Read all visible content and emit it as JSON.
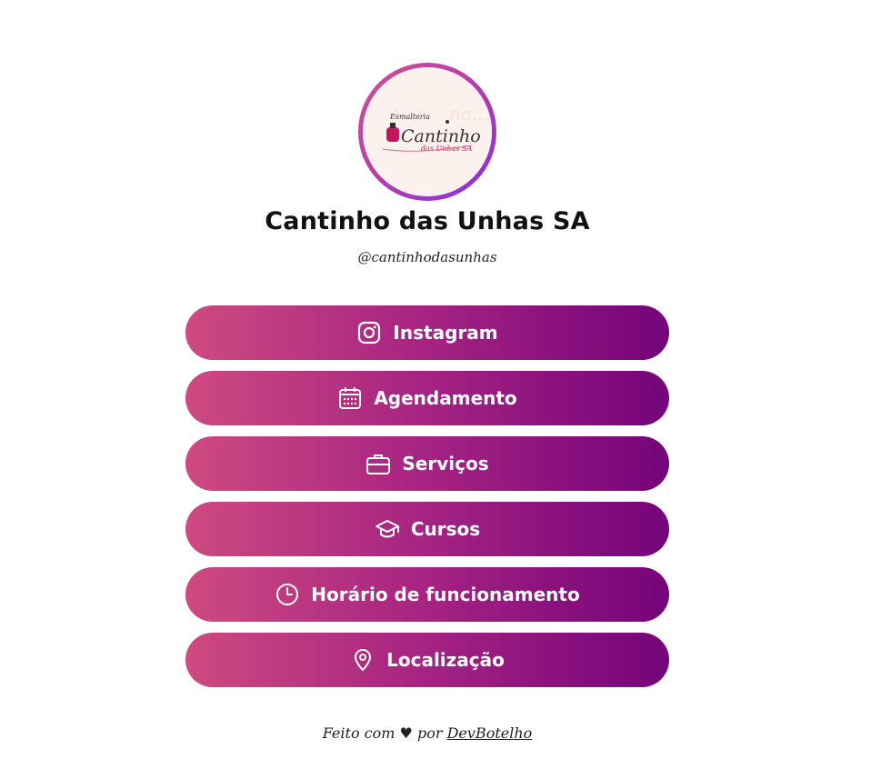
{
  "profile": {
    "name": "Cantinho das Unhas SA",
    "handle": "@cantinhodasunhas",
    "logo": {
      "top_text": "Esmalteria",
      "main_text": "Cantinho",
      "sub_text": "das Unhas SA"
    }
  },
  "links": [
    {
      "label": "Instagram",
      "icon": "instagram-icon"
    },
    {
      "label": "Agendamento",
      "icon": "calendar-icon"
    },
    {
      "label": "Serviços",
      "icon": "briefcase-icon"
    },
    {
      "label": "Cursos",
      "icon": "graduation-cap-icon"
    },
    {
      "label": "Horário de funcionamento",
      "icon": "clock-icon"
    },
    {
      "label": "Localização",
      "icon": "location-pin-icon"
    }
  ],
  "footer": {
    "prefix": "Feito com",
    "heart": "♥",
    "middle": "por",
    "author_link": "DevBotelho"
  },
  "colors": {
    "button_gradient_start": "#cf4a80",
    "button_gradient_end": "#74037a",
    "avatar_ring_start": "#d14f8f",
    "avatar_ring_end": "#8a2be2",
    "text": "#111111",
    "background": "#ffffff"
  }
}
